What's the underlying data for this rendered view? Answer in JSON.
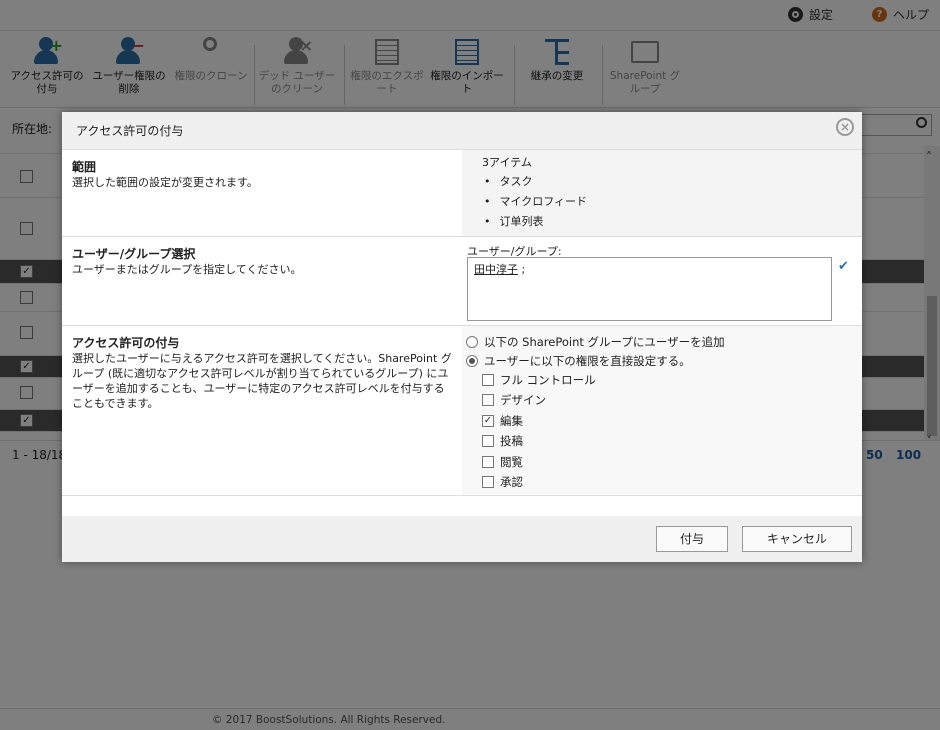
{
  "topbar": {
    "settings_label": "設定",
    "help_label": "ヘルプ",
    "help_icon_glyph": "?"
  },
  "ribbon": {
    "buttons": [
      {
        "label": "アクセス許可の付与",
        "icon": "add-user-icon",
        "enabled": true
      },
      {
        "label": "ユーザー権限の削除",
        "icon": "remove-user-icon",
        "enabled": true
      },
      {
        "label": "権限のクローン",
        "icon": "keys-icon",
        "enabled": false
      },
      {
        "label": "デッド ユーザーのクリーン",
        "icon": "dead-user-icon",
        "enabled": false
      },
      {
        "label": "権限のエクスポート",
        "icon": "export-icon",
        "enabled": false
      },
      {
        "label": "権限のインポート",
        "icon": "import-icon",
        "enabled": true
      },
      {
        "label": "継承の変更",
        "icon": "inheritance-icon",
        "enabled": true
      },
      {
        "label": "SharePoint グループ",
        "icon": "sharepoint-group-icon",
        "enabled": false
      }
    ]
  },
  "location": {
    "label": "所在地:"
  },
  "pager": {
    "count_text": "1 - 18/18",
    "page_sizes": [
      "50",
      "100"
    ]
  },
  "footer": {
    "copyright": "© 2017 BoostSolutions. All Rights Reserved."
  },
  "modal": {
    "title": "アクセス許可の付与",
    "close_glyph": "×",
    "scope": {
      "title": "範囲",
      "desc": "選択した範囲の設定が変更されます。",
      "count": "3アイテム",
      "items": [
        "タスク",
        "マイクロフィード",
        "订单列表"
      ]
    },
    "user_group": {
      "title": "ユーザー/グループ選択",
      "desc": "ユーザーまたはグループを指定してください。",
      "field_label": "ユーザー/グループ:",
      "value_user": "田中淳子",
      "value_sep": " ;"
    },
    "grant": {
      "title": "アクセス許可の付与",
      "desc": "選択したユーザーに与えるアクセス許可を選択してください。SharePoint グループ (既に適切なアクセス許可レベルが割り当てられているグループ) にユーザーを追加することも、ユーザーに特定のアクセス許可レベルを付与することもできます。",
      "radio_group_label": "以下の SharePoint グループにユーザーを追加",
      "radio_direct_label": "ユーザーに以下の権限を直接設定する。",
      "selected_radio": "direct",
      "permissions": [
        {
          "label": "フル コントロール",
          "checked": false
        },
        {
          "label": "デザイン",
          "checked": false
        },
        {
          "label": "編集",
          "checked": true
        },
        {
          "label": "投稿",
          "checked": false
        },
        {
          "label": "閲覧",
          "checked": false
        },
        {
          "label": "承認",
          "checked": false
        }
      ]
    },
    "buttons": {
      "grant": "付与",
      "cancel": "キャンセル"
    }
  },
  "colors": {
    "accent_blue": "#2d6fa8",
    "link_blue": "#1f5aa6",
    "add_green": "#2e9e2e",
    "remove_red": "#c0392b",
    "help_orange": "#d2691e"
  }
}
